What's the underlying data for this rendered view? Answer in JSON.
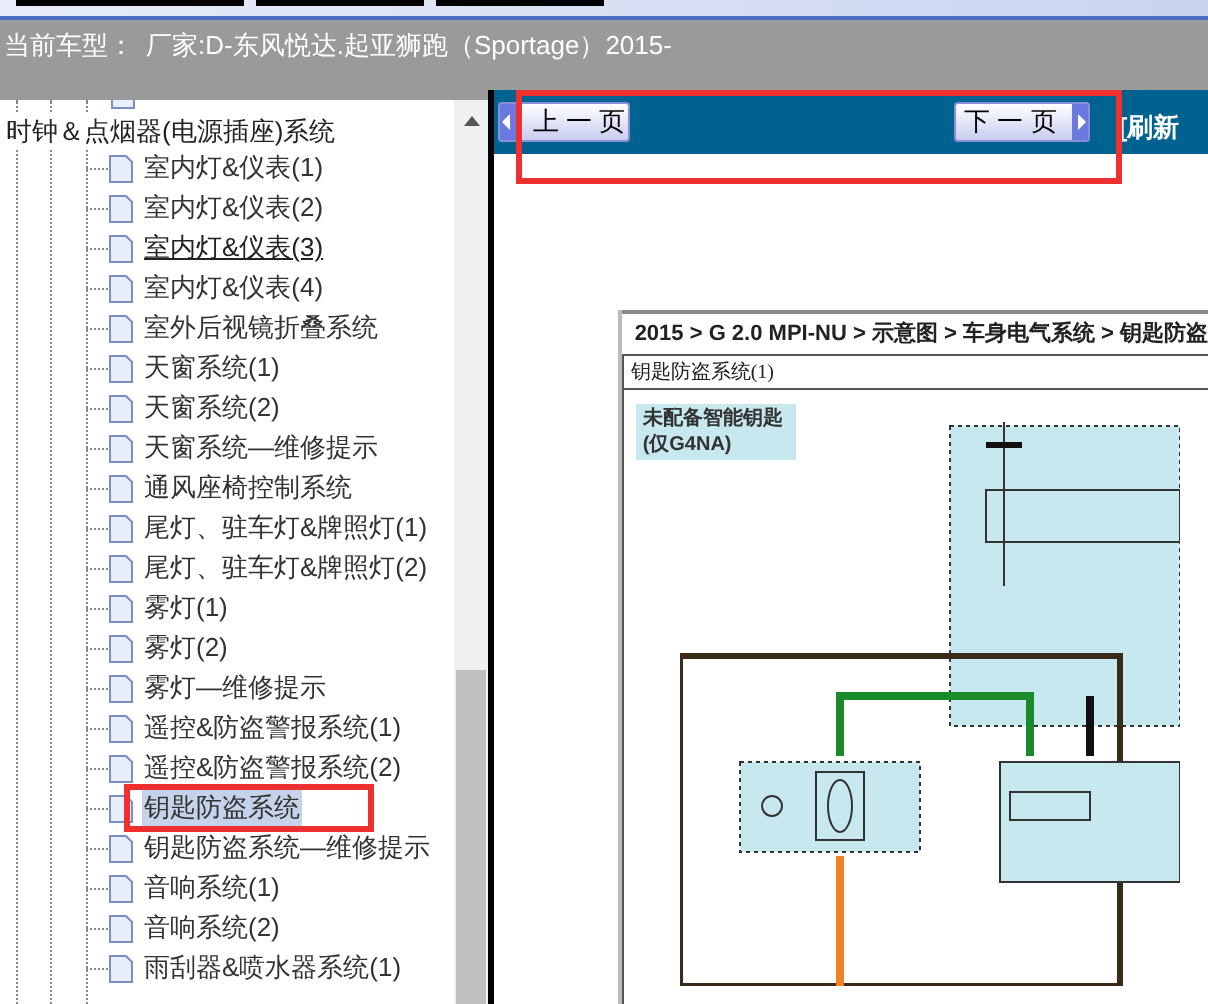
{
  "header": {
    "current_model_label": "当前车型：",
    "current_model": "厂家:D-东风悦达.起亚狮跑（Sportage）2015-"
  },
  "tree": {
    "label": "时钟＆点烟器(电源插座)系统",
    "children": [
      {
        "label": "室内灯&仪表(1)",
        "selected": false,
        "hovered": false
      },
      {
        "label": "室内灯&仪表(2)",
        "selected": false,
        "hovered": false
      },
      {
        "label": "室内灯&仪表(3)",
        "selected": false,
        "hovered": true
      },
      {
        "label": "室内灯&仪表(4)",
        "selected": false,
        "hovered": false
      },
      {
        "label": "室外后视镜折叠系统",
        "selected": false,
        "hovered": false
      },
      {
        "label": "天窗系统(1)",
        "selected": false,
        "hovered": false
      },
      {
        "label": "天窗系统(2)",
        "selected": false,
        "hovered": false
      },
      {
        "label": "天窗系统—维修提示",
        "selected": false,
        "hovered": false
      },
      {
        "label": "通风座椅控制系统",
        "selected": false,
        "hovered": false
      },
      {
        "label": "尾灯、驻车灯&牌照灯(1)",
        "selected": false,
        "hovered": false
      },
      {
        "label": "尾灯、驻车灯&牌照灯(2)",
        "selected": false,
        "hovered": false
      },
      {
        "label": "雾灯(1)",
        "selected": false,
        "hovered": false
      },
      {
        "label": "雾灯(2)",
        "selected": false,
        "hovered": false
      },
      {
        "label": "雾灯—维修提示",
        "selected": false,
        "hovered": false
      },
      {
        "label": "遥控&防盗警报系统(1)",
        "selected": false,
        "hovered": false
      },
      {
        "label": "遥控&防盗警报系统(2)",
        "selected": false,
        "hovered": false
      },
      {
        "label": "钥匙防盗系统",
        "selected": true,
        "hovered": false
      },
      {
        "label": "钥匙防盗系统—维修提示",
        "selected": false,
        "hovered": false
      },
      {
        "label": "音响系统(1)",
        "selected": false,
        "hovered": false
      },
      {
        "label": "音响系统(2)",
        "selected": false,
        "hovered": false
      },
      {
        "label": "雨刮器&喷水器系统(1)",
        "selected": false,
        "hovered": false
      }
    ]
  },
  "toolbar": {
    "prev": "上 一 页",
    "next": "下 一 页",
    "refresh": "[刷新"
  },
  "document": {
    "breadcrumb": "2015 > G 2.0 MPI-NU > 示意图 > 车身电气系统 > 钥匙防盗",
    "section_title": "钥匙防盗系统(1)",
    "note_lines": [
      "未配备智能钥匙",
      "(仅G4NA)"
    ]
  }
}
